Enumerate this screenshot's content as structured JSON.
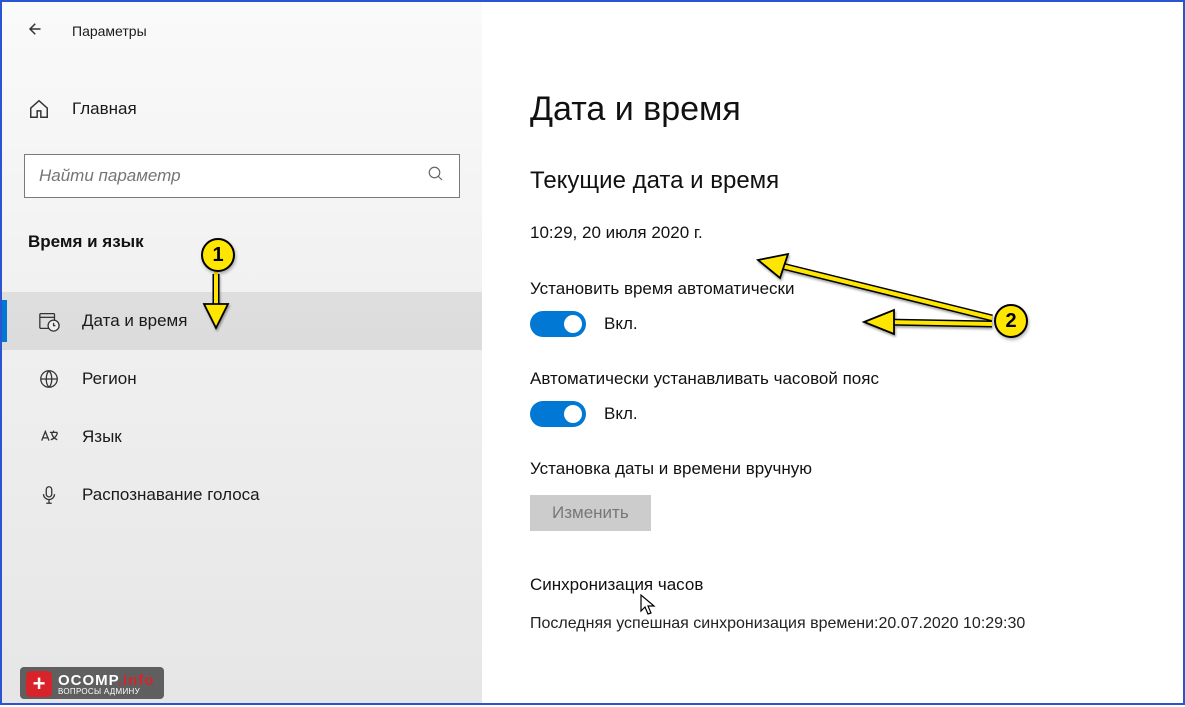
{
  "titlebar": {
    "title": "Параметры"
  },
  "sidebar": {
    "home_label": "Главная",
    "search_placeholder": "Найти параметр",
    "category": "Время и язык",
    "items": [
      {
        "label": "Дата и время"
      },
      {
        "label": "Регион"
      },
      {
        "label": "Язык"
      },
      {
        "label": "Распознавание голоса"
      }
    ]
  },
  "main": {
    "title": "Дата и время",
    "current_section": "Текущие дата и время",
    "current_value": "10:29, 20 июля 2020 г.",
    "auto_time_label": "Установить время автоматически",
    "auto_time_state": "Вкл.",
    "auto_tz_label": "Автоматически устанавливать часовой пояс",
    "auto_tz_state": "Вкл.",
    "manual_label": "Установка даты и времени вручную",
    "change_button": "Изменить",
    "sync_title": "Синхронизация часов",
    "sync_value": "Последняя успешная синхронизация времени:20.07.2020 10:29:30"
  },
  "annotations": {
    "badge1": "1",
    "badge2": "2"
  },
  "logo": {
    "main_a": "OCOMP",
    "main_b": ".info",
    "sub": "ВОПРОСЫ АДМИНУ"
  }
}
